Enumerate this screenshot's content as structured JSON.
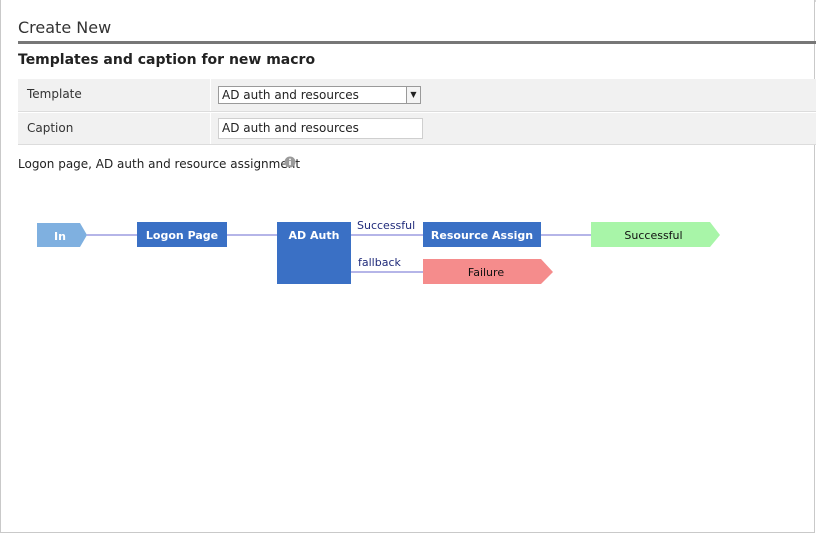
{
  "dialog": {
    "title": "Create New",
    "section_title": "Templates and caption for new macro"
  },
  "form": {
    "template_label": "Template",
    "template_value": "AD auth and resources",
    "caption_label": "Caption",
    "caption_value": "AD auth and resources"
  },
  "description": "Logon page, AD auth and resource assignment",
  "icons": {
    "info": "info-icon",
    "select_arrow": "chevron-down-icon"
  },
  "flow": {
    "nodes": {
      "in": "In",
      "logon_page": "Logon Page",
      "ad_auth": "AD Auth",
      "resource_assign": "Resource Assign",
      "successful": "Successful",
      "failure": "Failure"
    },
    "edges": {
      "successful": "Successful",
      "fallback": "fallback"
    },
    "colors": {
      "terminal_in": "#7fb0e0",
      "action": "#3a70c5",
      "ending_success": "#a8f5a8",
      "ending_failure": "#f58c8c",
      "line": "#6b6bd0"
    }
  }
}
